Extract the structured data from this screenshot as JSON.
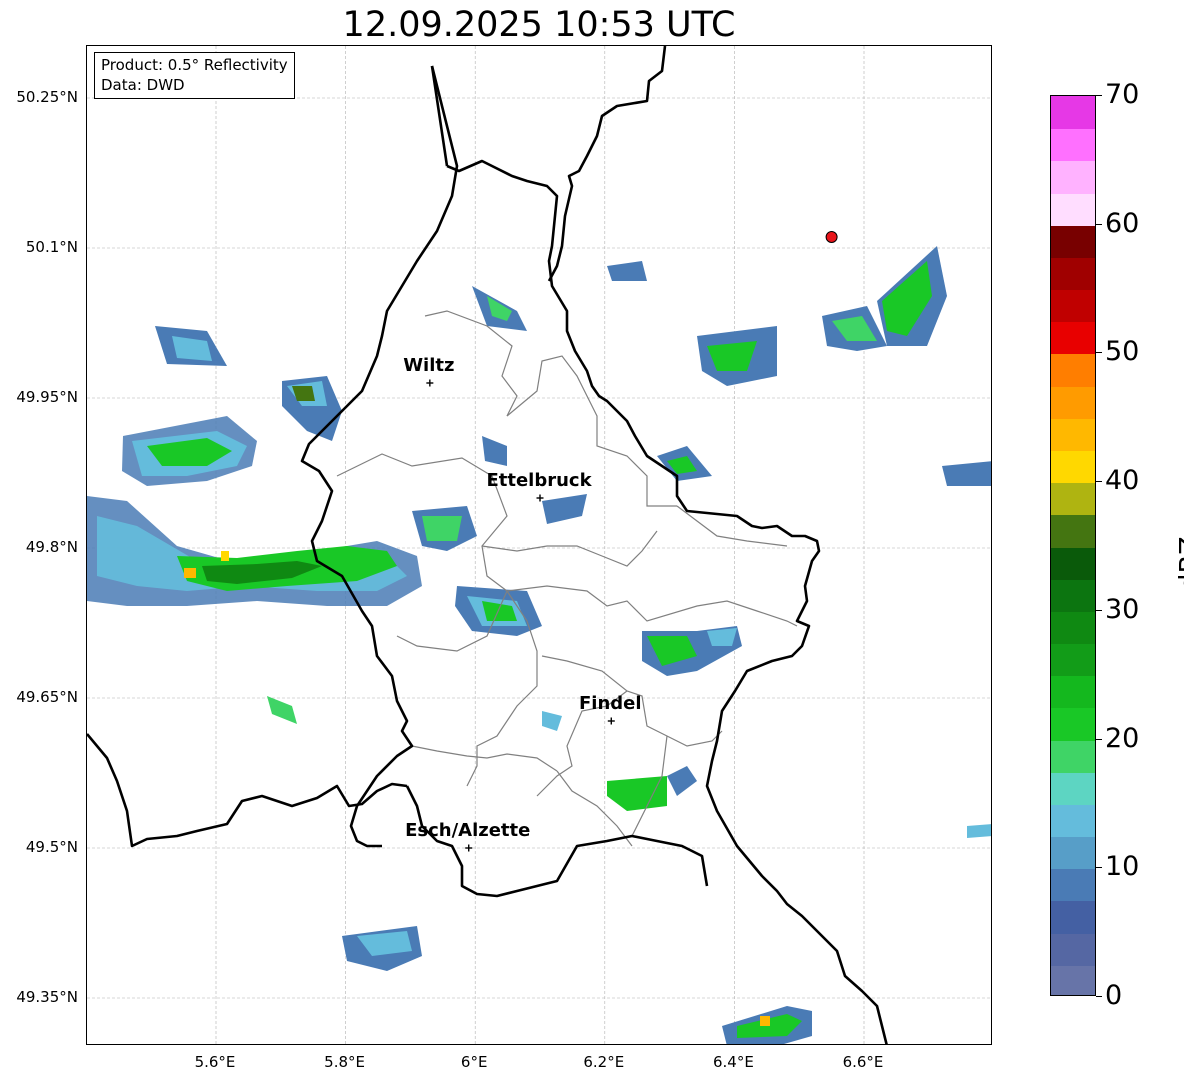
{
  "title": "12.09.2025 10:53 UTC",
  "info_box": {
    "product": "Product: 0.5° Reflectivity",
    "source": "Data: DWD"
  },
  "latitude_labels": [
    "50.25°N",
    "50.1°N",
    "49.95°N",
    "49.8°N",
    "49.65°N",
    "49.5°N",
    "49.35°N"
  ],
  "longitude_labels": [
    "5.6°E",
    "5.8°E",
    "6°E",
    "6.2°E",
    "6.4°E",
    "6.6°E"
  ],
  "cities": [
    {
      "name": "Wiltz",
      "lon": 5.93,
      "lat": 49.965
    },
    {
      "name": "Ettelbruck",
      "lon": 6.1,
      "lat": 49.85
    },
    {
      "name": "Findel",
      "lon": 6.21,
      "lat": 49.627
    },
    {
      "name": "Esch/Alzette",
      "lon": 5.99,
      "lat": 49.5
    }
  ],
  "radar_site_marker": {
    "lon": 6.55,
    "lat": 50.111,
    "color": "#e8141a"
  },
  "colorbar": {
    "label": "dBZ",
    "tick_labels": [
      "0",
      "10",
      "20",
      "30",
      "40",
      "50",
      "60",
      "70"
    ],
    "min": 0,
    "max": 70,
    "step": 2.5,
    "colors": [
      "#6774a8",
      "#5567a3",
      "#4460a3",
      "#4a7bb5",
      "#579ec8",
      "#64bcdc",
      "#5dd5c2",
      "#3fd466",
      "#19c826",
      "#14b81e",
      "#129c18",
      "#0f8912",
      "#0c7510",
      "#0a5a0a",
      "#447511",
      "#afb411",
      "#ffd800",
      "#ffb800",
      "#ff9b00",
      "#ff7e00",
      "#e80000",
      "#c00000",
      "#a00000",
      "#780000",
      "#ffddff",
      "#ffb2ff",
      "#ff70ff",
      "#e638e6"
    ]
  },
  "map_colors": {
    "country_border": "#000000",
    "canton_border": "#808080",
    "grid": "#b0b0b0"
  }
}
